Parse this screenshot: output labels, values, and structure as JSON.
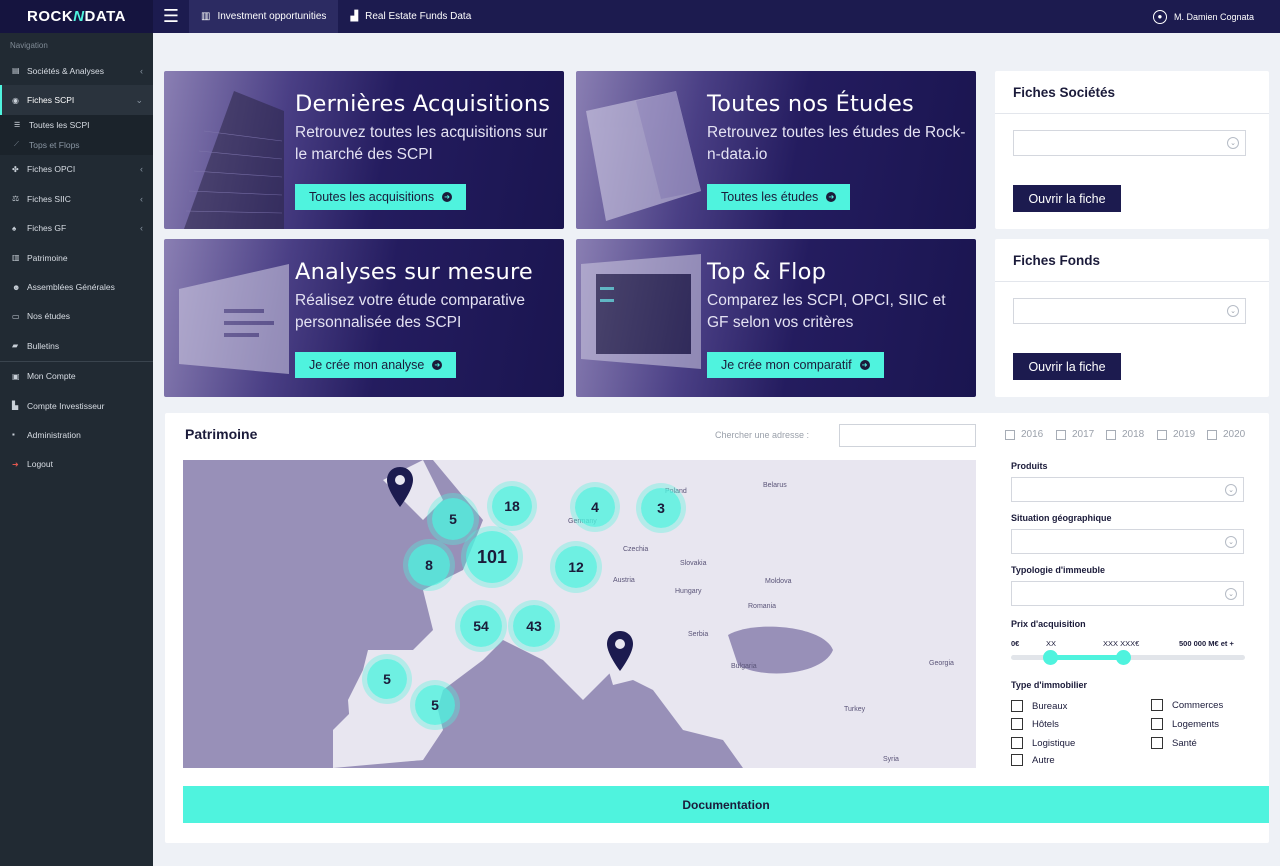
{
  "topbar": {
    "logo_left": "ROCK",
    "logo_mid": "N",
    "logo_right": "DATA",
    "menu_icon": "hamburger-icon",
    "tabs": [
      {
        "label": "Investment opportunities",
        "icon": "building-icon"
      },
      {
        "label": "Real Estate Funds Data",
        "icon": "chart-icon"
      }
    ],
    "user": {
      "name": "M. Damien Cognata",
      "icon": "user-circle-icon"
    }
  },
  "sidebar": {
    "nav_label": "Navigation",
    "items": [
      {
        "label": "Sociétés & Analyses",
        "icon": "bank-icon"
      },
      {
        "label": "Fiches SCPI",
        "icon": "palette-icon"
      },
      {
        "label": "Toutes les SCPI",
        "icon": "list-icon"
      },
      {
        "label": "Tops et Flops",
        "icon": "line-chart-icon"
      },
      {
        "label": "Fiches OPCI",
        "icon": "puzzle-icon"
      },
      {
        "label": "Fiches SIIC",
        "icon": "scale-icon"
      },
      {
        "label": "Fiches GF",
        "icon": "tree-icon"
      },
      {
        "label": "Patrimoine",
        "icon": "building-icon"
      },
      {
        "label": "Assemblées Générales",
        "icon": "users-icon"
      },
      {
        "label": "Nos études",
        "icon": "laptop-icon"
      },
      {
        "label": "Bulletins",
        "icon": "book-icon"
      },
      {
        "label": "Mon Compte",
        "icon": "id-card-icon"
      },
      {
        "label": "Compte Investisseur",
        "icon": "bar-chart-icon"
      },
      {
        "label": "Administration",
        "icon": "lock-icon"
      },
      {
        "label": "Logout",
        "icon": "logout-icon"
      }
    ]
  },
  "cards": [
    {
      "title": "Dernières Acquisitions",
      "text": "Retrouvez toutes les acquisitions sur le marché des SCPI",
      "button": "Toutes les acquisitions"
    },
    {
      "title": "Toutes nos Études",
      "text": "Retrouvez toutes les études de Rock-n-data.io",
      "button": "Toutes les études"
    },
    {
      "title": "Analyses sur mesure",
      "text": "Réalisez votre étude comparative personnalisée des SCPI",
      "button": "Je crée mon analyse"
    },
    {
      "title": "Top & Flop",
      "text": "Comparez les SCPI, OPCI, SIIC et GF selon vos critères",
      "button": "Je crée mon comparatif"
    }
  ],
  "fiches_societes": {
    "title": "Fiches Sociétés",
    "select_value": "",
    "button": "Ouvrir la fiche"
  },
  "fiches_fonds": {
    "title": "Fiches Fonds",
    "select_value": "",
    "button": "Ouvrir la fiche"
  },
  "patrimoine": {
    "title": "Patrimoine",
    "search_label": "Chercher une adresse :",
    "search_value": "",
    "years": [
      "2016",
      "2017",
      "2018",
      "2019",
      "2020"
    ],
    "map_labels": [
      "Belarus",
      "Poland",
      "Czechia",
      "Slovakia",
      "Austria",
      "Hungary",
      "Moldova",
      "Romania",
      "Serbia",
      "Bulgaria",
      "Georgia",
      "Turkey",
      "Syria",
      "Germany"
    ],
    "clusters": [
      "5",
      "18",
      "4",
      "3",
      "8",
      "101",
      "12",
      "54",
      "43",
      "5",
      "5"
    ],
    "filters": {
      "produits": "Produits",
      "situation": "Situation géographique",
      "typologie": "Typologie d'immeuble",
      "prix": "Prix d'acquisition",
      "prix_min": "0€",
      "prix_low": "XX",
      "prix_high": "XXX XXX€",
      "prix_max": "500 000 M€ et +",
      "prix_low_fraction": 0.17,
      "prix_high_fraction": 0.48,
      "type_label": "Type d'immobilier",
      "types": [
        "Bureaux",
        "Commerces",
        "Hôtels",
        "Logements",
        "Logistique",
        "Santé",
        "Autre"
      ]
    },
    "doc_button": "Documentation"
  },
  "colors": {
    "accent": "#4ff3de",
    "navy": "#1c1b4f",
    "sidebar": "#212a33"
  }
}
